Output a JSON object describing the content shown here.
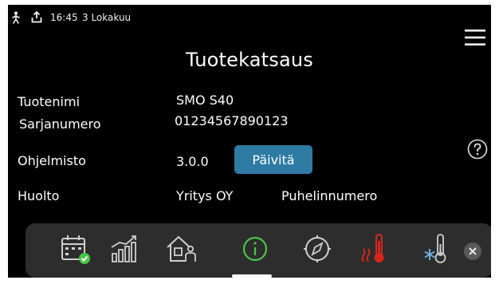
{
  "status_bar": {
    "time": "16:45",
    "date": "3 Lokakuu"
  },
  "page": {
    "title": "Tuotekatsaus"
  },
  "info": {
    "product_name_label": "Tuotenimi",
    "product_name_value": "SMO S40",
    "serial_label": "Sarjanumero",
    "serial_value": "01234567890123",
    "software_label": "Ohjelmisto",
    "software_value": "3.0.0",
    "update_label": "Päivitä",
    "service_label": "Huolto",
    "service_company": "Yritys OY",
    "service_phone": "Puhelinnumero"
  },
  "colors": {
    "background": "#000000",
    "accent_button": "#2e7ba3",
    "active_icon": "#49c44a",
    "heat_icon": "#d8261c",
    "cool_icon": "#6fb7e6",
    "dock": "#2d2d2d"
  },
  "dock": {
    "items": [
      {
        "icon": "calendar-check-icon"
      },
      {
        "icon": "bar-chart-icon"
      },
      {
        "icon": "house-person-icon"
      },
      {
        "icon": "info-icon"
      },
      {
        "icon": "compass-icon"
      },
      {
        "icon": "thermometer-heat-icon"
      },
      {
        "icon": "thermometer-cool-icon"
      }
    ],
    "active_index": 3
  }
}
